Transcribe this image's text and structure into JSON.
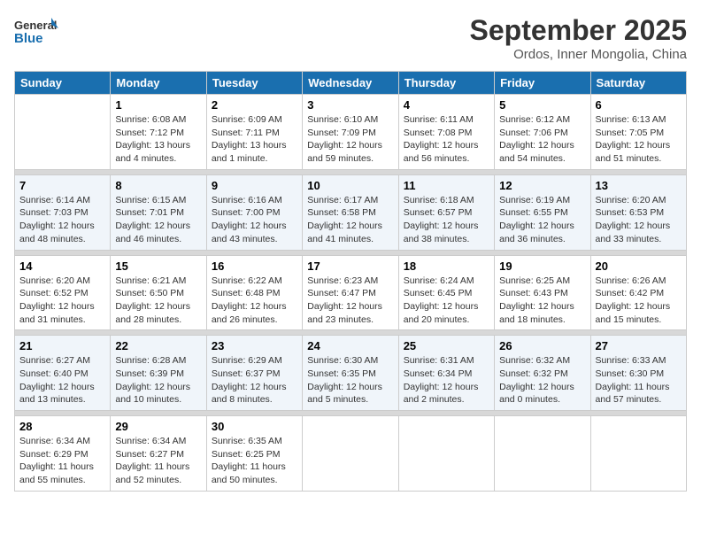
{
  "header": {
    "logo_line1": "General",
    "logo_line2": "Blue",
    "month": "September 2025",
    "location": "Ordos, Inner Mongolia, China"
  },
  "days_of_week": [
    "Sunday",
    "Monday",
    "Tuesday",
    "Wednesday",
    "Thursday",
    "Friday",
    "Saturday"
  ],
  "weeks": [
    [
      {
        "day": "",
        "sunrise": "",
        "sunset": "",
        "daylight": ""
      },
      {
        "day": "1",
        "sunrise": "Sunrise: 6:08 AM",
        "sunset": "Sunset: 7:12 PM",
        "daylight": "Daylight: 13 hours and 4 minutes."
      },
      {
        "day": "2",
        "sunrise": "Sunrise: 6:09 AM",
        "sunset": "Sunset: 7:11 PM",
        "daylight": "Daylight: 13 hours and 1 minute."
      },
      {
        "day": "3",
        "sunrise": "Sunrise: 6:10 AM",
        "sunset": "Sunset: 7:09 PM",
        "daylight": "Daylight: 12 hours and 59 minutes."
      },
      {
        "day": "4",
        "sunrise": "Sunrise: 6:11 AM",
        "sunset": "Sunset: 7:08 PM",
        "daylight": "Daylight: 12 hours and 56 minutes."
      },
      {
        "day": "5",
        "sunrise": "Sunrise: 6:12 AM",
        "sunset": "Sunset: 7:06 PM",
        "daylight": "Daylight: 12 hours and 54 minutes."
      },
      {
        "day": "6",
        "sunrise": "Sunrise: 6:13 AM",
        "sunset": "Sunset: 7:05 PM",
        "daylight": "Daylight: 12 hours and 51 minutes."
      }
    ],
    [
      {
        "day": "7",
        "sunrise": "Sunrise: 6:14 AM",
        "sunset": "Sunset: 7:03 PM",
        "daylight": "Daylight: 12 hours and 48 minutes."
      },
      {
        "day": "8",
        "sunrise": "Sunrise: 6:15 AM",
        "sunset": "Sunset: 7:01 PM",
        "daylight": "Daylight: 12 hours and 46 minutes."
      },
      {
        "day": "9",
        "sunrise": "Sunrise: 6:16 AM",
        "sunset": "Sunset: 7:00 PM",
        "daylight": "Daylight: 12 hours and 43 minutes."
      },
      {
        "day": "10",
        "sunrise": "Sunrise: 6:17 AM",
        "sunset": "Sunset: 6:58 PM",
        "daylight": "Daylight: 12 hours and 41 minutes."
      },
      {
        "day": "11",
        "sunrise": "Sunrise: 6:18 AM",
        "sunset": "Sunset: 6:57 PM",
        "daylight": "Daylight: 12 hours and 38 minutes."
      },
      {
        "day": "12",
        "sunrise": "Sunrise: 6:19 AM",
        "sunset": "Sunset: 6:55 PM",
        "daylight": "Daylight: 12 hours and 36 minutes."
      },
      {
        "day": "13",
        "sunrise": "Sunrise: 6:20 AM",
        "sunset": "Sunset: 6:53 PM",
        "daylight": "Daylight: 12 hours and 33 minutes."
      }
    ],
    [
      {
        "day": "14",
        "sunrise": "Sunrise: 6:20 AM",
        "sunset": "Sunset: 6:52 PM",
        "daylight": "Daylight: 12 hours and 31 minutes."
      },
      {
        "day": "15",
        "sunrise": "Sunrise: 6:21 AM",
        "sunset": "Sunset: 6:50 PM",
        "daylight": "Daylight: 12 hours and 28 minutes."
      },
      {
        "day": "16",
        "sunrise": "Sunrise: 6:22 AM",
        "sunset": "Sunset: 6:48 PM",
        "daylight": "Daylight: 12 hours and 26 minutes."
      },
      {
        "day": "17",
        "sunrise": "Sunrise: 6:23 AM",
        "sunset": "Sunset: 6:47 PM",
        "daylight": "Daylight: 12 hours and 23 minutes."
      },
      {
        "day": "18",
        "sunrise": "Sunrise: 6:24 AM",
        "sunset": "Sunset: 6:45 PM",
        "daylight": "Daylight: 12 hours and 20 minutes."
      },
      {
        "day": "19",
        "sunrise": "Sunrise: 6:25 AM",
        "sunset": "Sunset: 6:43 PM",
        "daylight": "Daylight: 12 hours and 18 minutes."
      },
      {
        "day": "20",
        "sunrise": "Sunrise: 6:26 AM",
        "sunset": "Sunset: 6:42 PM",
        "daylight": "Daylight: 12 hours and 15 minutes."
      }
    ],
    [
      {
        "day": "21",
        "sunrise": "Sunrise: 6:27 AM",
        "sunset": "Sunset: 6:40 PM",
        "daylight": "Daylight: 12 hours and 13 minutes."
      },
      {
        "day": "22",
        "sunrise": "Sunrise: 6:28 AM",
        "sunset": "Sunset: 6:39 PM",
        "daylight": "Daylight: 12 hours and 10 minutes."
      },
      {
        "day": "23",
        "sunrise": "Sunrise: 6:29 AM",
        "sunset": "Sunset: 6:37 PM",
        "daylight": "Daylight: 12 hours and 8 minutes."
      },
      {
        "day": "24",
        "sunrise": "Sunrise: 6:30 AM",
        "sunset": "Sunset: 6:35 PM",
        "daylight": "Daylight: 12 hours and 5 minutes."
      },
      {
        "day": "25",
        "sunrise": "Sunrise: 6:31 AM",
        "sunset": "Sunset: 6:34 PM",
        "daylight": "Daylight: 12 hours and 2 minutes."
      },
      {
        "day": "26",
        "sunrise": "Sunrise: 6:32 AM",
        "sunset": "Sunset: 6:32 PM",
        "daylight": "Daylight: 12 hours and 0 minutes."
      },
      {
        "day": "27",
        "sunrise": "Sunrise: 6:33 AM",
        "sunset": "Sunset: 6:30 PM",
        "daylight": "Daylight: 11 hours and 57 minutes."
      }
    ],
    [
      {
        "day": "28",
        "sunrise": "Sunrise: 6:34 AM",
        "sunset": "Sunset: 6:29 PM",
        "daylight": "Daylight: 11 hours and 55 minutes."
      },
      {
        "day": "29",
        "sunrise": "Sunrise: 6:34 AM",
        "sunset": "Sunset: 6:27 PM",
        "daylight": "Daylight: 11 hours and 52 minutes."
      },
      {
        "day": "30",
        "sunrise": "Sunrise: 6:35 AM",
        "sunset": "Sunset: 6:25 PM",
        "daylight": "Daylight: 11 hours and 50 minutes."
      },
      {
        "day": "",
        "sunrise": "",
        "sunset": "",
        "daylight": ""
      },
      {
        "day": "",
        "sunrise": "",
        "sunset": "",
        "daylight": ""
      },
      {
        "day": "",
        "sunrise": "",
        "sunset": "",
        "daylight": ""
      },
      {
        "day": "",
        "sunrise": "",
        "sunset": "",
        "daylight": ""
      }
    ]
  ]
}
